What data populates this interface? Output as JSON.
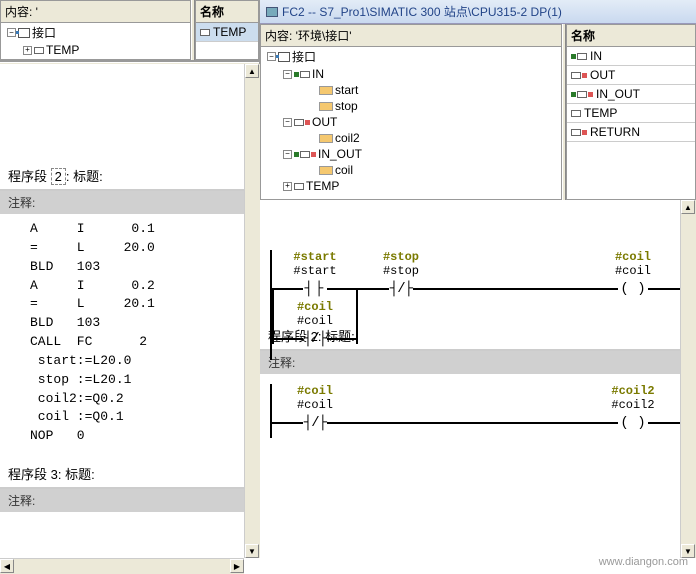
{
  "left": {
    "content_label": "内容:  '",
    "tree": {
      "root": "接口",
      "temp": "TEMP"
    },
    "table": {
      "header": "名称",
      "row1": "TEMP"
    },
    "seg2": {
      "title_prefix": "程序段 ",
      "num": "2",
      "title_suffix": ": 标题:"
    },
    "seg3": {
      "title_prefix": "程序段 ",
      "num": "3",
      "title_suffix": ": 标题:"
    },
    "comment": "注释:",
    "stl": "A     I      0.1\n=     L     20.0\nBLD   103\nA     I      0.2\n=     L     20.1\nBLD   103\nCALL  FC      2\n start:=L20.0\n stop :=L20.1\n coil2:=Q0.2\n coil :=Q0.1\nNOP   0"
  },
  "right": {
    "title": "FC2 -- S7_Pro1\\SIMATIC 300 站点\\CPU315-2 DP(1)",
    "content_label": "内容:  '环境\\接口'",
    "tree": {
      "root": "接口",
      "in": "IN",
      "in_items": [
        "start",
        "stop"
      ],
      "out": "OUT",
      "out_items": [
        "coil2"
      ],
      "inout": "IN_OUT",
      "inout_items": [
        "coil"
      ],
      "temp": "TEMP"
    },
    "table": {
      "header": "名称",
      "rows": [
        "IN",
        "OUT",
        "IN_OUT",
        "TEMP",
        "RETURN"
      ]
    },
    "net1": {
      "start": {
        "sym": "#start",
        "txt": "#start"
      },
      "stop": {
        "sym": "#stop",
        "txt": "#stop"
      },
      "coil": {
        "sym": "#coil",
        "txt": "#coil"
      },
      "coil_b": {
        "sym": "#coil",
        "txt": "#coil"
      }
    },
    "seg2": {
      "title_prefix": "程序段 ",
      "num": "2",
      "title_suffix": ": 标题:"
    },
    "comment": "注释:",
    "net2": {
      "coil": {
        "sym": "#coil",
        "txt": "#coil"
      },
      "coil2": {
        "sym": "#coil2",
        "txt": "#coil2"
      }
    }
  },
  "watermark": "www.diangon.com"
}
